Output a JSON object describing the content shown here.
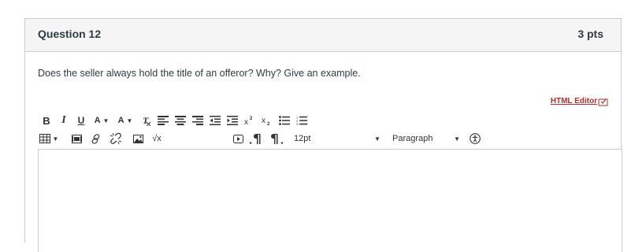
{
  "question": {
    "title": "Question 12",
    "points": "3 pts",
    "text": "Does the seller always hold the title of an offeror? Why? Give an example."
  },
  "editor": {
    "html_editor_link": "HTML Editor",
    "font_size": "12pt",
    "paragraph": "Paragraph",
    "toolbar_row1": [
      "bold",
      "italic",
      "underline",
      "text-color",
      "background-color",
      "clear-formatting",
      "align-left",
      "align-center",
      "align-right",
      "indent",
      "outdent",
      "superscript",
      "subscript",
      "bullet-list",
      "numbered-list"
    ],
    "toolbar_row2": [
      "table",
      "media",
      "link",
      "unlink",
      "image",
      "equation",
      "embed",
      "ltr",
      "rtl",
      "font-size",
      "paragraph",
      "accessibility"
    ],
    "labels": {
      "bold": "B",
      "italic": "I",
      "underline": "U",
      "textcolor": "A",
      "bgcolor": "A",
      "sqrt": "√x"
    }
  }
}
